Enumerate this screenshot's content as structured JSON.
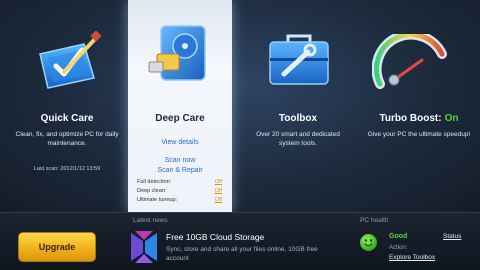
{
  "modules": {
    "quick_care": {
      "title": "Quick Care",
      "description": "Clean, fix, and optimize PC for daily maintenance.",
      "last_scan": "Last scan: 2012/1/12 13:59"
    },
    "deep_care": {
      "title": "Deep Care",
      "view_details": "View details",
      "scan_now": "Scan now",
      "scan_repair": "Scan & Repair",
      "statuses": [
        {
          "label": "Full detection:",
          "value": "Off"
        },
        {
          "label": "Deep clean:",
          "value": "Off"
        },
        {
          "label": "Ultimate tuneup:",
          "value": "Off"
        }
      ]
    },
    "toolbox": {
      "title": "Toolbox",
      "description": "Over 20 smart and dedicated system tools."
    },
    "turbo_boost": {
      "title": "Turbo Boost:",
      "state": "On",
      "description": "Give your PC the ultimate speedup!"
    }
  },
  "footer": {
    "upgrade_label": "Upgrade",
    "news": {
      "section_label": "Latest news",
      "title": "Free 10GB Cloud Storage",
      "description": "Sync, store and share all your files online, 10GB free account"
    },
    "health": {
      "section_label": "PC health",
      "state": "Good",
      "action_label": "Action:",
      "action_link": "Explore Toolbox",
      "status_link": "Status"
    }
  },
  "colors": {
    "accent_green": "#56d23c",
    "off_orange": "#e88a10",
    "upgrade_gold": "#f0b21a",
    "link_blue": "#2a6cc2"
  },
  "icons": [
    "quick-care-icon",
    "deep-care-icon",
    "toolbox-icon",
    "turbo-gauge-icon",
    "news-logo-icon",
    "health-smiley-icon"
  ]
}
